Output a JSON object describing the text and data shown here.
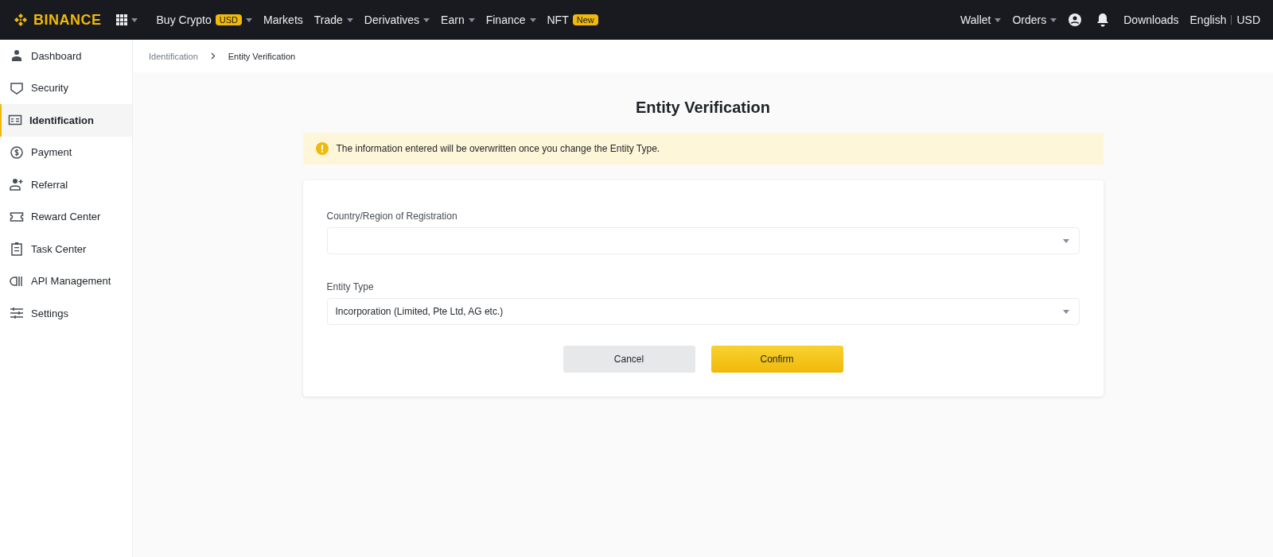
{
  "top_nav": {
    "logo": "BINANCE",
    "items": [
      {
        "label": "Buy Crypto",
        "badge": "USD",
        "dropdown": true
      },
      {
        "label": "Markets",
        "dropdown": false
      },
      {
        "label": "Trade",
        "dropdown": true
      },
      {
        "label": "Derivatives",
        "dropdown": true
      },
      {
        "label": "Earn",
        "dropdown": true
      },
      {
        "label": "Finance",
        "dropdown": true
      },
      {
        "label": "NFT",
        "badge": "New",
        "dropdown": false
      }
    ],
    "right_menus": [
      {
        "label": "Wallet",
        "dropdown": true
      },
      {
        "label": "Orders",
        "dropdown": true
      }
    ],
    "downloads": "Downloads",
    "language": "English",
    "currency": "USD"
  },
  "sidebar": {
    "items": [
      {
        "label": "Dashboard",
        "selected": false
      },
      {
        "label": "Security",
        "selected": false
      },
      {
        "label": "Identification",
        "selected": true
      },
      {
        "label": "Payment",
        "selected": false
      },
      {
        "label": "Referral",
        "selected": false
      },
      {
        "label": "Reward Center",
        "selected": false
      },
      {
        "label": "Task Center",
        "selected": false
      },
      {
        "label": "API Management",
        "selected": false
      },
      {
        "label": "Settings",
        "selected": false
      }
    ]
  },
  "breadcrumb": [
    "Identification",
    "Entity Verification"
  ],
  "page_title": "Entity Verification",
  "warning": "The information entered will be overwritten once you change the Entity Type.",
  "form": {
    "fields": [
      {
        "label": "Country/Region of Registration"
      },
      {
        "label": "Entity Type",
        "value": "Incorporation (Limited, Pte Ltd, AG etc.)"
      }
    ],
    "buttons": [
      {
        "label": "Cancel",
        "kind": "secondary"
      },
      {
        "label": "Confirm",
        "kind": "primary"
      }
    ]
  }
}
